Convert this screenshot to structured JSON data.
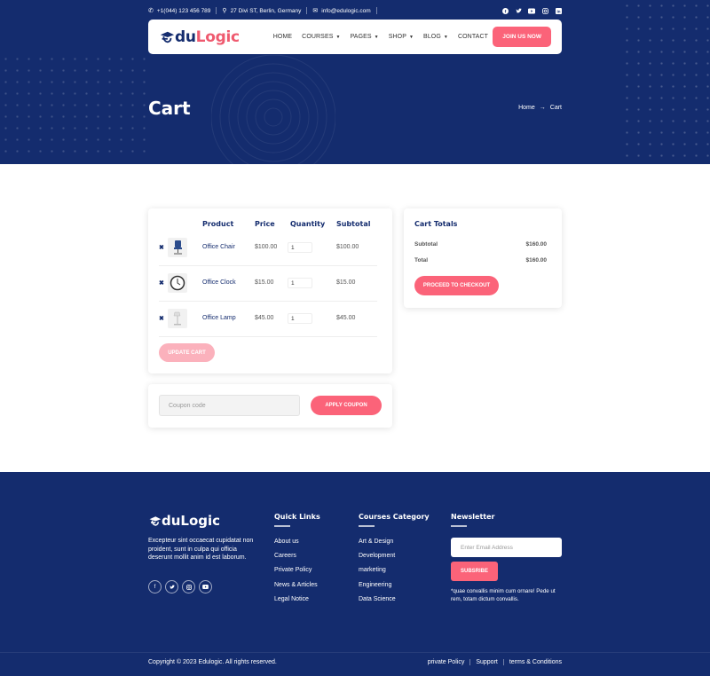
{
  "topbar": {
    "phone": "+1(044) 123 456 789",
    "address": "27 Divi ST, Berlin, Germany",
    "email": "info@edulogic.com",
    "social_icons": [
      "facebook-icon",
      "twitter-icon",
      "youtube-icon",
      "instagram-icon",
      "linkedin-icon"
    ]
  },
  "brand": {
    "logo_prefix": "E",
    "logo_main": "du",
    "logo_accent": "Logic"
  },
  "nav": {
    "items": [
      {
        "label": "HOME"
      },
      {
        "label": "COURSES"
      },
      {
        "label": "PAGES"
      },
      {
        "label": "SHOP"
      },
      {
        "label": "BLOG"
      },
      {
        "label": "CONTACT"
      }
    ],
    "cta": "JOIN US NOW"
  },
  "hero": {
    "title": "Cart",
    "breadcrumb_home": "Home",
    "breadcrumb_sep": "→",
    "breadcrumb_current": "Cart"
  },
  "cart": {
    "headers": {
      "product": "Product",
      "price": "Price",
      "quantity": "Quantity",
      "subtotal": "Subtotal"
    },
    "remove_glyph": "✖",
    "rows": [
      {
        "name": "Office Chair",
        "price": "$100.00",
        "qty": "1",
        "subtotal": "$100.00",
        "icon": "office-chair-icon"
      },
      {
        "name": "Office Clock",
        "price": "$15.00",
        "qty": "1",
        "subtotal": "$15.00",
        "icon": "office-clock-icon"
      },
      {
        "name": "Office Lamp",
        "price": "$45.00",
        "qty": "1",
        "subtotal": "$45.00",
        "icon": "office-lamp-icon"
      }
    ],
    "update_label": "UPDATE CART",
    "coupon_placeholder": "Coupon code",
    "apply_label": "APPLY COUPON"
  },
  "totals": {
    "title": "Cart Totals",
    "subtotal_label": "Subtotal",
    "subtotal_value": "$160.00",
    "total_label": "Total",
    "total_value": "$160.00",
    "checkout_label": "PROCEED TO CHECKOUT"
  },
  "footer": {
    "logo_prefix": "E",
    "logo_text": "duLogic",
    "description": "Excepteur sint occaecat cupidatat non proident, sunt in culpa qui officia deserunt mollit anim id est laborum.",
    "quick_links_title": "Quick Links",
    "quick_links": [
      "About us",
      "Careers",
      "Private Policy",
      "News & Articles",
      "Legal Notice"
    ],
    "courses_title": "Courses Category",
    "courses": [
      "Art & Design",
      "Development",
      "marketing",
      "Engineering",
      "Data Science"
    ],
    "newsletter_title": "Newsletter",
    "email_placeholder": "Enter Email Address",
    "subscribe_label": "SUBSRIBE",
    "newsletter_note": "*quae convallis minim cum ornare! Pede ut rem, totam dictum convallis.",
    "copyright": "Copyright © 2023 Edulogic. All rights reserved.",
    "bottom_links": [
      "private Policy",
      "Support",
      "terms & Conditions"
    ]
  },
  "colors": {
    "navy": "#142c6e",
    "accent": "#fb6379",
    "accent_light": "#fbb1bc"
  }
}
